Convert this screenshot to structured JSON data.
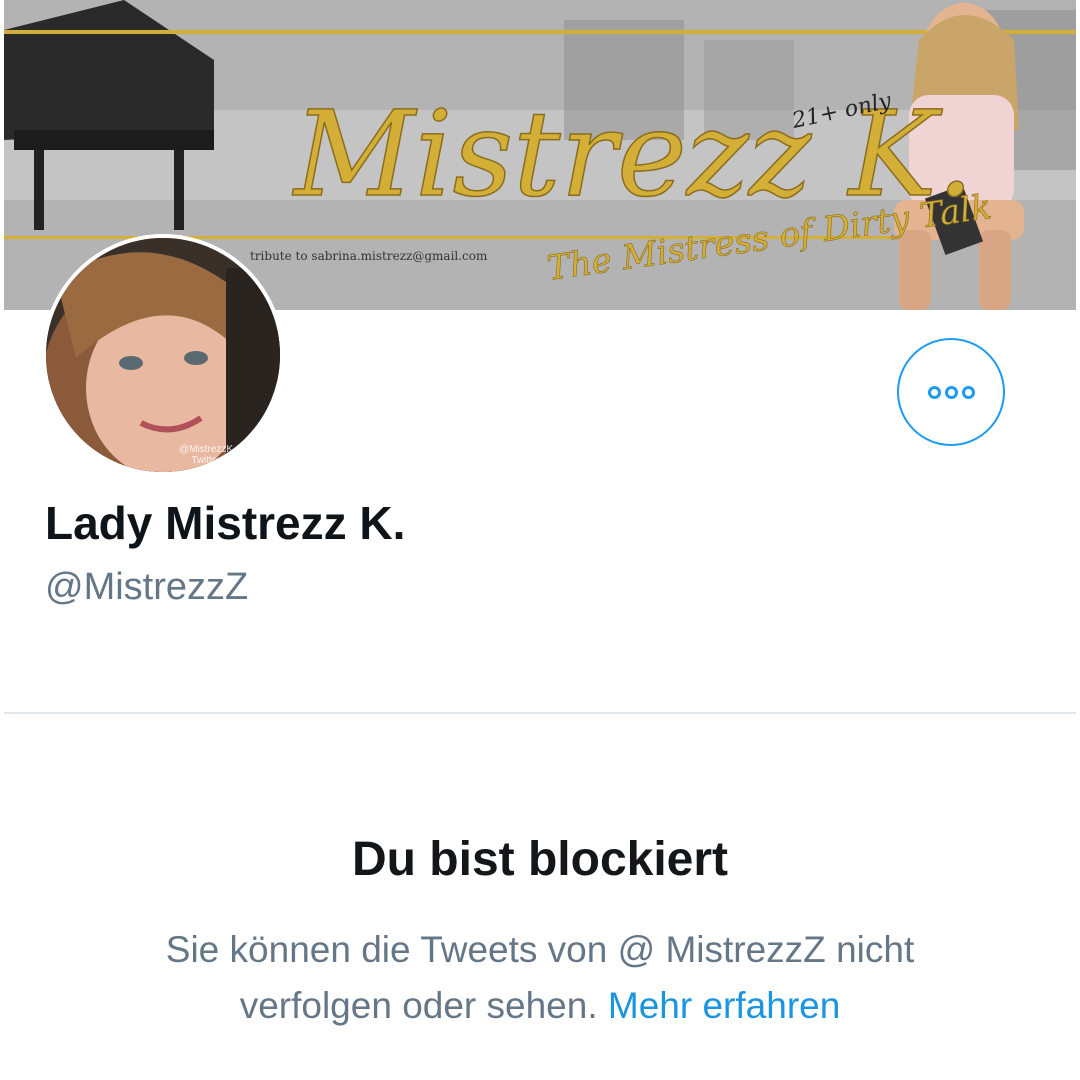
{
  "banner": {
    "script_title": "Mistrezz K.",
    "script_tag": "21+ only",
    "email_line": "tribute to sabrina.mistrezz@gmail.com",
    "subtitle": "The Mistress of Dirty Talk"
  },
  "avatar": {
    "watermark_handle": "@MistrezzK",
    "watermark_site": "Twitter"
  },
  "more_button": {
    "icon": "more-horizontal-icon"
  },
  "profile": {
    "display_name": "Lady Mistrezz K.",
    "handle": "@MistrezzZ"
  },
  "blocked": {
    "title": "Du bist blockiert",
    "message": "Sie können die Tweets von @ MistrezzZ nicht verfolgen oder sehen.",
    "learn_more": "Mehr erfahren"
  },
  "colors": {
    "accent": "#1d9bf0",
    "link": "#1b95e0",
    "text_primary": "#14171a",
    "text_secondary": "#657786",
    "divider": "#e1e8ed",
    "banner_gold": "#d4af37"
  }
}
